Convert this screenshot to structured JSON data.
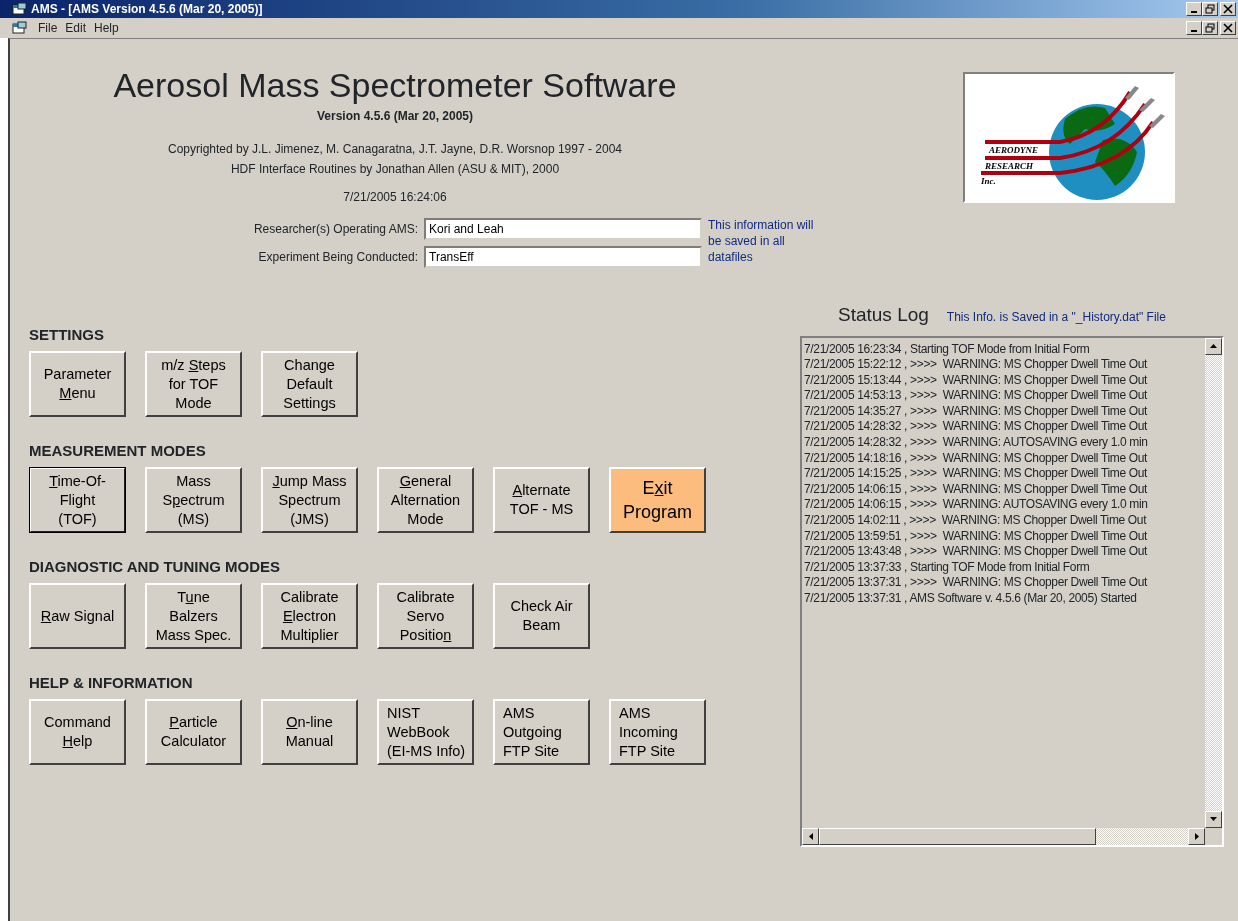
{
  "window": {
    "title": "AMS - [AMS Version 4.5.6 (Mar 20, 2005)]"
  },
  "menu": [
    "File",
    "Edit",
    "Help"
  ],
  "header": {
    "title": "Aerosol Mass Spectrometer Software",
    "version": "Version 4.5.6 (Mar 20, 2005)",
    "credits": [
      "Copyrighted by J.L. Jimenez, M. Canagaratna, J.T. Jayne, D.R. Worsnop 1997 - 2004",
      "HDF Interface Routines by Jonathan Allen (ASU & MIT), 2000"
    ],
    "datetime": "7/21/2005 16:24:06"
  },
  "logo": {
    "lines": [
      "AERODYNE",
      "RESEARCH",
      "Inc."
    ]
  },
  "fields": [
    {
      "label": "Researcher(s) Operating AMS:",
      "value": "Kori and Leah"
    },
    {
      "label": "Experiment Being Conducted:",
      "value": "TransEff"
    }
  ],
  "fields_note": "This information will be saved in all datafiles",
  "sections": [
    {
      "heading": "SETTINGS",
      "buttons": [
        {
          "label": [
            {
              "text": "Parameter\n",
              "underlined": false
            },
            {
              "text": "M",
              "underlined": true
            },
            {
              "text": "enu",
              "underlined": false
            }
          ],
          "kind": "normal",
          "default": false
        },
        {
          "label": [
            {
              "text": "m/z ",
              "underlined": false
            },
            {
              "text": "S",
              "underlined": true
            },
            {
              "text": "teps\nfor TOF\nMode",
              "underlined": false
            }
          ],
          "kind": "normal",
          "default": false
        },
        {
          "label": [
            {
              "text": "Change\nDefault\nSettings",
              "underlined": false
            }
          ],
          "kind": "normal",
          "default": false
        }
      ]
    },
    {
      "heading": "MEASUREMENT MODES",
      "buttons": [
        {
          "label": [
            {
              "text": "T",
              "underlined": true
            },
            {
              "text": "ime-Of-\nFlight\n(TOF)",
              "underlined": false
            }
          ],
          "kind": "normal",
          "default": true
        },
        {
          "label": [
            {
              "text": "Mass\nS",
              "underlined": false
            },
            {
              "text": "p",
              "underlined": true
            },
            {
              "text": "ectrum\n(MS)",
              "underlined": false
            }
          ],
          "kind": "normal",
          "default": false
        },
        {
          "label": [
            {
              "text": "J",
              "underlined": true
            },
            {
              "text": "ump Mass\nSpectrum\n(JMS)",
              "underlined": false
            }
          ],
          "kind": "normal",
          "default": false
        },
        {
          "label": [
            {
              "text": "G",
              "underlined": true
            },
            {
              "text": "eneral\nAlternation\nMode",
              "underlined": false
            }
          ],
          "kind": "normal",
          "default": false
        },
        {
          "label": [
            {
              "text": "A",
              "underlined": true
            },
            {
              "text": "lternate\nTOF - MS",
              "underlined": false
            }
          ],
          "kind": "normal",
          "default": false
        },
        {
          "label": [
            {
              "text": "E",
              "underlined": false
            },
            {
              "text": "x",
              "underlined": true
            },
            {
              "text": "it\nProgram",
              "underlined": false
            }
          ],
          "kind": "exit",
          "default": false
        }
      ]
    },
    {
      "heading": "DIAGNOSTIC AND TUNING  MODES",
      "buttons": [
        {
          "label": [
            {
              "text": "R",
              "underlined": true
            },
            {
              "text": "aw Signal",
              "underlined": false
            }
          ],
          "kind": "normal",
          "default": false
        },
        {
          "label": [
            {
              "text": "T",
              "underlined": false
            },
            {
              "text": "u",
              "underlined": true
            },
            {
              "text": "ne\nBalzers\nMass Spec.",
              "underlined": false
            }
          ],
          "kind": "normal",
          "default": false
        },
        {
          "label": [
            {
              "text": "Calibrate\n",
              "underlined": false
            },
            {
              "text": "E",
              "underlined": true
            },
            {
              "text": "lectron\nMultiplier",
              "underlined": false
            }
          ],
          "kind": "normal",
          "default": false
        },
        {
          "label": [
            {
              "text": "Calibrate\nServo\nPositio",
              "underlined": false
            },
            {
              "text": "n",
              "underlined": true
            }
          ],
          "kind": "normal",
          "default": false
        },
        {
          "label": [
            {
              "text": "Check Air\nBeam",
              "underlined": false
            }
          ],
          "kind": "normal",
          "default": false
        }
      ]
    },
    {
      "heading": "HELP & INFORMATION",
      "buttons": [
        {
          "label": [
            {
              "text": "Command\n",
              "underlined": false
            },
            {
              "text": "H",
              "underlined": true
            },
            {
              "text": "elp",
              "underlined": false
            }
          ],
          "kind": "normal",
          "default": false
        },
        {
          "label": [
            {
              "text": "P",
              "underlined": true
            },
            {
              "text": "article\nCalculator",
              "underlined": false
            }
          ],
          "kind": "normal",
          "default": false
        },
        {
          "label": [
            {
              "text": "O",
              "underlined": true
            },
            {
              "text": "n-line\nManual",
              "underlined": false
            }
          ],
          "kind": "normal",
          "default": false
        },
        {
          "label": [
            {
              "text": "NIST\nWebBook\n(EI-MS Info)",
              "underlined": false
            }
          ],
          "kind": "left",
          "default": false
        },
        {
          "label": [
            {
              "text": "AMS\nOutgoing\nFTP Site",
              "underlined": false
            }
          ],
          "kind": "left",
          "default": false
        },
        {
          "label": [
            {
              "text": "AMS\nIncoming\nFTP Site",
              "underlined": false
            }
          ],
          "kind": "left",
          "default": false
        }
      ]
    }
  ],
  "status_log": {
    "title": "Status Log",
    "note": "This Info. is Saved in a \"_History.dat\" File",
    "entries": [
      "7/21/2005 16:23:34 , Starting TOF Mode from Initial Form",
      "7/21/2005 15:22:12 , >>>>  WARNING: MS Chopper Dwell Time Out",
      "7/21/2005 15:13:44 , >>>>  WARNING: MS Chopper Dwell Time Out",
      "7/21/2005 14:53:13 , >>>>  WARNING: MS Chopper Dwell Time Out",
      "7/21/2005 14:35:27 , >>>>  WARNING: MS Chopper Dwell Time Out",
      "7/21/2005 14:28:32 , >>>>  WARNING: MS Chopper Dwell Time Out",
      "7/21/2005 14:28:32 , >>>>  WARNING: AUTOSAVING every 1.0 min",
      "7/21/2005 14:18:16 , >>>>  WARNING: MS Chopper Dwell Time Out",
      "7/21/2005 14:15:25 , >>>>  WARNING: MS Chopper Dwell Time Out",
      "7/21/2005 14:06:15 , >>>>  WARNING: MS Chopper Dwell Time Out",
      "7/21/2005 14:06:15 , >>>>  WARNING: AUTOSAVING every 1.0 min",
      "7/21/2005 14:02:11 , >>>>  WARNING: MS Chopper Dwell Time Out",
      "7/21/2005 13:59:51 , >>>>  WARNING: MS Chopper Dwell Time Out",
      "7/21/2005 13:43:48 , >>>>  WARNING: MS Chopper Dwell Time Out",
      "7/21/2005 13:37:33 , Starting TOF Mode from Initial Form",
      "7/21/2005 13:37:31 , >>>>  WARNING: MS Chopper Dwell Time Out",
      "7/21/2005 13:37:31 , AMS Software v. 4.5.6 (Mar 20, 2005) Started"
    ]
  }
}
